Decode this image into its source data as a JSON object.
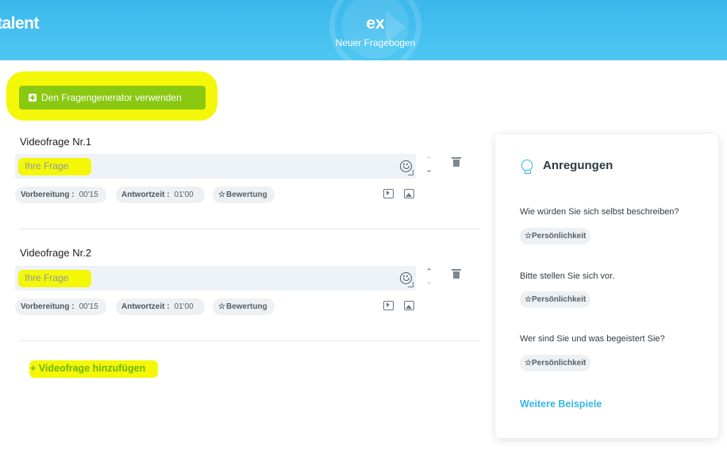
{
  "header": {
    "logo": "talent",
    "brand": "ex",
    "subtitle": "Neuer Fragebogen"
  },
  "generator": {
    "label": "Den Fragengenerator verwenden"
  },
  "questions": [
    {
      "title": "Videofrage Nr.1",
      "placeholder": "Ihre Frage",
      "prep_label": "Vorbereitung :",
      "prep_value": "00'15",
      "answer_label": "Antwortzeit :",
      "answer_value": "01'00",
      "rating_label": "Bewertung"
    },
    {
      "title": "Videofrage Nr.2",
      "placeholder": "Ihre Frage",
      "prep_label": "Vorbereitung :",
      "prep_value": "00'15",
      "answer_label": "Antwortzeit :",
      "answer_value": "01'00",
      "rating_label": "Bewertung"
    }
  ],
  "add_question": "+ Videofrage hinzufügen",
  "suggestions": {
    "title": "Anregungen",
    "items": [
      {
        "text": "Wie würden Sie sich selbst beschreiben?",
        "tag": "Persönlichkeit"
      },
      {
        "text": "Bitte stellen Sie sich vor.",
        "tag": "Persönlichkeit"
      },
      {
        "text": "Wer sind Sie und was begeistert Sie?",
        "tag": "Persönlichkeit"
      }
    ],
    "more": "Weitere Beispiele"
  },
  "colors": {
    "header": "#3bb7ec",
    "accent_green": "#8bc812",
    "link_blue": "#38b6e8",
    "highlight": "#f4f708"
  }
}
